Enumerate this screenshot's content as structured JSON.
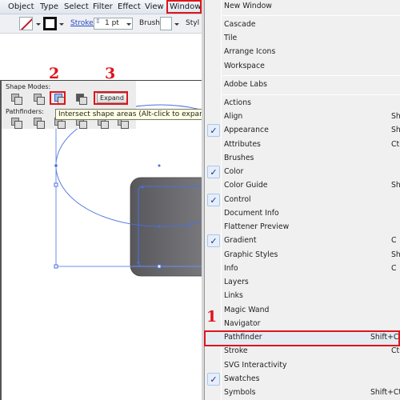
{
  "menubar": {
    "items": [
      "Object",
      "Type",
      "Select",
      "Filter",
      "Effect",
      "View",
      "Window"
    ]
  },
  "toolbar": {
    "stroke_label": "Stroke:",
    "stroke_value": "1 pt",
    "brush_label": "Brush:",
    "style_label": "Styl"
  },
  "pathfinder_panel": {
    "shape_modes_label": "Shape Modes:",
    "pathfinders_label": "Pathfinders:",
    "expand_label": "Expand",
    "tooltip": "Intersect shape areas (Alt-click to expand)"
  },
  "callouts": [
    "1",
    "2",
    "3"
  ],
  "colors": {
    "callout": "#e0141b",
    "selection": "#4a6fe0",
    "shape_fill_dark": "#5a5a5e",
    "shape_fill_light": "#8a8a8e",
    "menu_bg": "#f0f0f0"
  },
  "window_menu": {
    "group1": [
      "New Window"
    ],
    "group2": [
      "Cascade",
      "Tile",
      "Arrange Icons",
      "Workspace"
    ],
    "group3": [
      "Adobe Labs"
    ],
    "panels": [
      {
        "label": "Actions",
        "shortcut": "",
        "checked": false
      },
      {
        "label": "Align",
        "shortcut": "Sh",
        "checked": false
      },
      {
        "label": "Appearance",
        "shortcut": "Sh",
        "checked": true
      },
      {
        "label": "Attributes",
        "shortcut": "Ctr",
        "checked": false
      },
      {
        "label": "Brushes",
        "shortcut": "",
        "checked": false
      },
      {
        "label": "Color",
        "shortcut": "",
        "checked": true
      },
      {
        "label": "Color Guide",
        "shortcut": "Sh",
        "checked": false
      },
      {
        "label": "Control",
        "shortcut": "",
        "checked": true
      },
      {
        "label": "Document Info",
        "shortcut": "",
        "checked": false
      },
      {
        "label": "Flattener Preview",
        "shortcut": "",
        "checked": false
      },
      {
        "label": "Gradient",
        "shortcut": "C",
        "checked": true
      },
      {
        "label": "Graphic Styles",
        "shortcut": "Sh",
        "checked": false
      },
      {
        "label": "Info",
        "shortcut": "C",
        "checked": false
      },
      {
        "label": "Layers",
        "shortcut": "",
        "checked": false
      },
      {
        "label": "Links",
        "shortcut": "",
        "checked": false
      },
      {
        "label": "Magic Wand",
        "shortcut": "",
        "checked": false
      },
      {
        "label": "Navigator",
        "shortcut": "",
        "checked": false
      },
      {
        "label": "Pathfinder",
        "shortcut": "Shift+C",
        "checked": false,
        "highlighted": true
      },
      {
        "label": "Stroke",
        "shortcut": "Ctr",
        "checked": false
      },
      {
        "label": "SVG Interactivity",
        "shortcut": "",
        "checked": false
      },
      {
        "label": "Swatches",
        "shortcut": "",
        "checked": true
      },
      {
        "label": "Symbols",
        "shortcut": "Shift+Ctr",
        "checked": false
      }
    ]
  }
}
